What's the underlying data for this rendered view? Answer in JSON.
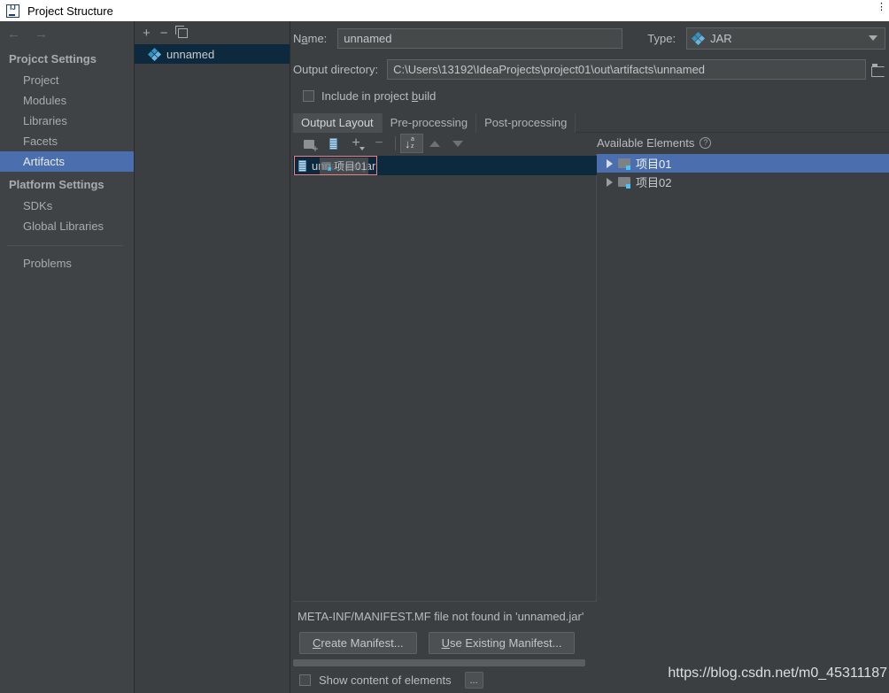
{
  "window": {
    "title": "Project Structure",
    "logo_icon": "intellij-idea-logo-icon",
    "close_dots": "⋮"
  },
  "nav": {
    "back_icon": "arrow-left-icon",
    "forward_icon": "arrow-right-icon"
  },
  "sidebar": {
    "groups": [
      {
        "label": "Projcct Settings",
        "items": [
          {
            "label": "Project",
            "selected": false
          },
          {
            "label": "Modules",
            "selected": false
          },
          {
            "label": "Libraries",
            "selected": false
          },
          {
            "label": "Facets",
            "selected": false
          },
          {
            "label": "Artifacts",
            "selected": true
          }
        ]
      },
      {
        "label": "Platform Settings",
        "items": [
          {
            "label": "SDKs",
            "selected": false
          },
          {
            "label": "Global Libraries",
            "selected": false
          }
        ]
      }
    ],
    "footer_items": [
      {
        "label": "Problems",
        "selected": false
      }
    ],
    "selected_color": "#4b6eaf"
  },
  "artifacts_panel": {
    "toolbar": {
      "add_icon": "plus-icon",
      "add_label": "+",
      "remove_icon": "minus-icon",
      "remove_label": "−",
      "copy_icon": "copy-icon"
    },
    "items": [
      {
        "label": "unnamed",
        "icon": "jar-artifact-icon",
        "selected": true
      }
    ]
  },
  "detail": {
    "name_field": {
      "label": "Name:",
      "label_pre": "N",
      "label_mnemonic": "a",
      "label_post": "me:",
      "value": "unnamed",
      "placeholder": "unnamed"
    },
    "type_field": {
      "label": "Type:",
      "value": "JAR",
      "icon": "jar-artifact-icon",
      "caret_icon": "chevron-down-icon"
    },
    "output_directory": {
      "label": "Output directory:",
      "value": "C:\\Users\\13192\\IdeaProjects\\project01\\out\\artifacts\\unnamed",
      "placeholder": "C:\\Users\\13192\\IdeaProjects\\project01\\out\\artifacts\\unnamed",
      "browse_icon": "folder-icon"
    },
    "include_in_build": {
      "label": "Include in project build",
      "label_pre": "Include in project ",
      "label_mnemonic": "b",
      "label_post": "uild",
      "checked": false
    },
    "tabs": [
      {
        "label": "Output Layout",
        "active": true
      },
      {
        "label": "Pre-processing",
        "active": false
      },
      {
        "label": "Post-processing",
        "active": false
      }
    ],
    "layout_toolbar": {
      "add_directory_icon": "add-folder-icon",
      "add_archive_icon": "jar-file-icon",
      "add_copy_icon": "plus-dropdown-icon",
      "add_label": "+",
      "remove_icon": "minus-icon",
      "remove_label": "−",
      "sort_icon": "sort-alphabetical-icon",
      "sort_active": true,
      "move_up_icon": "arrow-up-icon",
      "move_down_icon": "arrow-down-icon"
    },
    "output_tree": {
      "root": {
        "label": "unnamed.jar",
        "icon": "jar-file-icon",
        "selected": true,
        "editing_outline_color": "#f08080"
      },
      "drag_ghost": {
        "label": "项目01",
        "icon": "module-icon"
      }
    },
    "available_elements": {
      "header": "Available Elements",
      "help_icon": "help-circle-icon",
      "help_label": "?",
      "items": [
        {
          "label": "项目01",
          "icon": "module-icon",
          "expander": "triangle-right-icon",
          "selected": true
        },
        {
          "label": "项目02",
          "icon": "module-icon",
          "expander": "triangle-right-icon",
          "selected": false
        }
      ]
    },
    "manifest": {
      "message": "META-INF/MANIFEST.MF file not found in 'unnamed.jar'",
      "buttons": [
        {
          "label": "Create Manifest...",
          "pre": "",
          "mnemonic": "C",
          "post": "reate Manifest..."
        },
        {
          "label": "Use Existing Manifest...",
          "pre": "",
          "mnemonic": "U",
          "post": "se Existing Manifest..."
        }
      ]
    },
    "bottom": {
      "show_content": {
        "label": "Show content of elements",
        "checked": false
      },
      "more_button_label": "...",
      "scrollbar_icon": "horizontal-scrollbar"
    }
  },
  "watermark": "https://blog.csdn.net/m0_45311187"
}
